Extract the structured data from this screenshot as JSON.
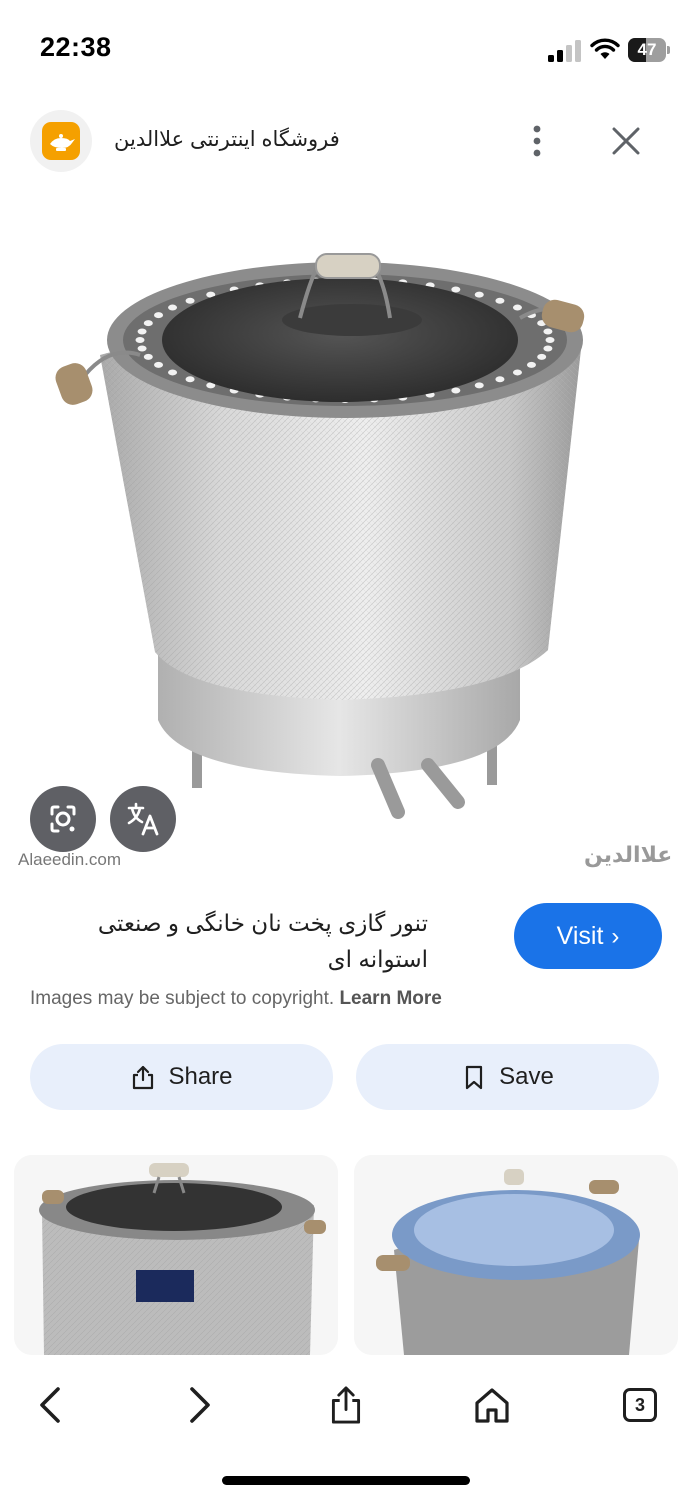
{
  "status_bar": {
    "time": "22:38",
    "battery_level": "47",
    "battery_fraction": 0.47,
    "icons": [
      "signal-icon",
      "wifi-icon",
      "battery-icon"
    ]
  },
  "header": {
    "site_title": "فروشگاه اینترنتی علاالدین",
    "favicon_color": "#f5a000",
    "more_icon": "more-vert-icon",
    "close_icon": "close-icon"
  },
  "image": {
    "source_url": "Alaeedin.com",
    "watermark": "علاالدین",
    "lens_icon": "google-lens-icon",
    "translate_icon": "translate-icon"
  },
  "result": {
    "title": "تنور گازی پخت نان خانگی و صنعتی استوانه ای",
    "visit_label": "Visit",
    "copyright_text": "Images may be subject to copyright.",
    "learn_more_label": "Learn More"
  },
  "actions": {
    "share_label": "Share",
    "save_label": "Save"
  },
  "toolbar": {
    "back_icon": "back-icon",
    "forward_icon": "forward-icon",
    "share_icon": "share-icon",
    "home_icon": "home-icon",
    "tabs_count": "3"
  },
  "colors": {
    "accent": "#1a73e8",
    "action_bg": "#e8effb",
    "icon_button_bg": "#5f6065"
  }
}
